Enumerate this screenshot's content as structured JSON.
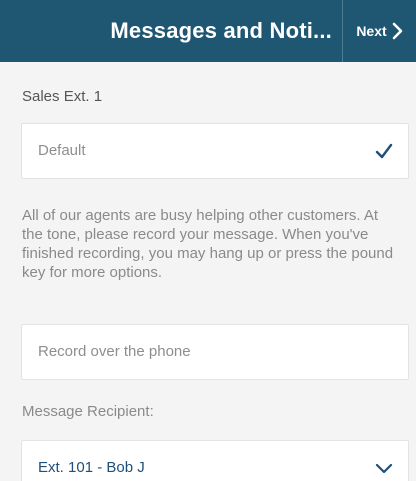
{
  "header": {
    "title": "Messages and Noti...",
    "next_label": "Next"
  },
  "sales_label": "Sales  Ext. 1",
  "greeting_select": {
    "value": "Default",
    "icon": "checkmark-icon"
  },
  "message_text": "All of our agents are busy helping other customers. At the tone, please record your message. When you've finished recording, you may hang up or press the pound key for more options.",
  "record_option": {
    "label": "Record over the phone"
  },
  "recipient": {
    "label": "Message Recipient:",
    "value": "Ext. 101 - Bob J",
    "icon": "chevron-down-icon"
  },
  "colors": {
    "header_bg": "#1f5772",
    "accent": "#1f4f7a",
    "page_bg": "#f4f4f4"
  }
}
